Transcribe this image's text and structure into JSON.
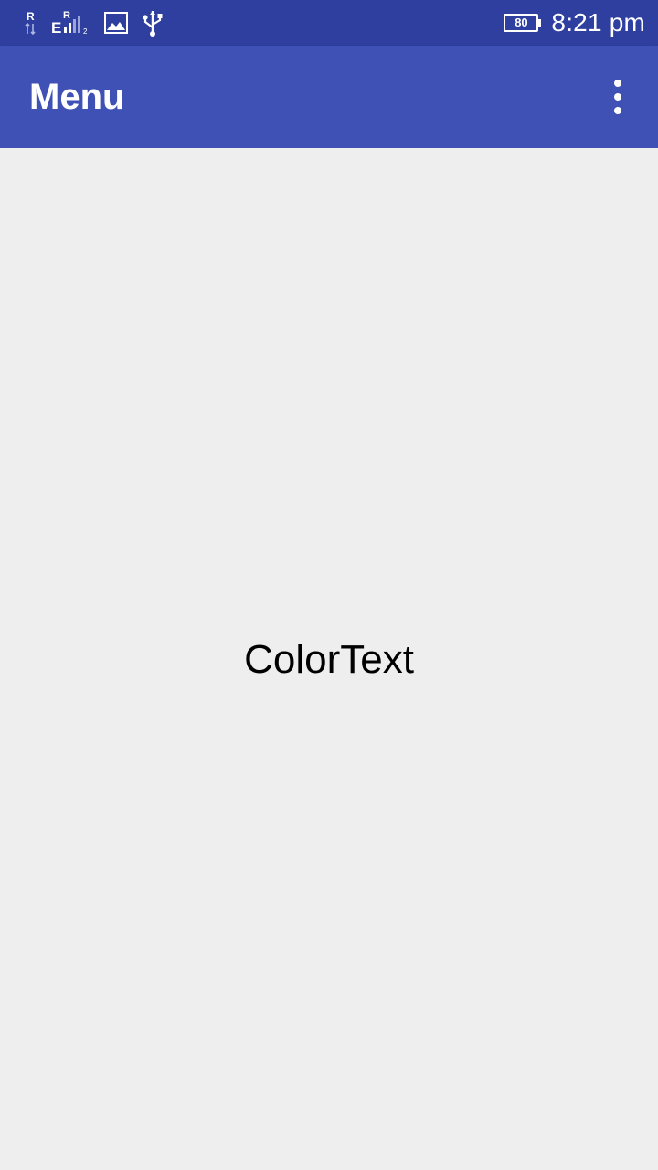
{
  "status_bar": {
    "icons": [
      "data-roaming-icon",
      "signal-roaming-icon",
      "image-notification-icon",
      "usb-icon"
    ],
    "battery_level": "80",
    "time": "8:21 pm"
  },
  "app_bar": {
    "title": "Menu",
    "overflow_icon": "more-vert-icon",
    "color": "#3f51b5"
  },
  "content": {
    "text": "ColorText"
  },
  "colors": {
    "status_bar": "#2e3f9f",
    "app_bar": "#3f51b5",
    "background": "#eeeeee"
  }
}
